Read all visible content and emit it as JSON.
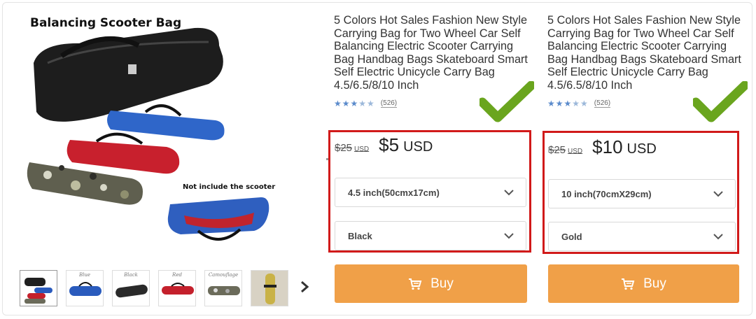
{
  "gallery": {
    "title": "Balancing Scooter Bag",
    "note": "Not include the scooter",
    "thumbnails": [
      {
        "label": "",
        "color": "#1f1f1f"
      },
      {
        "label": "Blue",
        "color": "#2a5bbd"
      },
      {
        "label": "Black",
        "color": "#2a2a2a"
      },
      {
        "label": "Red",
        "color": "#c4202c"
      },
      {
        "label": "Camouflage",
        "color": "#6b6b5a"
      },
      {
        "label": "",
        "color": "#c9b247"
      }
    ],
    "next_icon": "chevron-right-icon"
  },
  "products": [
    {
      "title": "5 Colors Hot Sales Fashion New Style Carrying Bag for Two Wheel Car Self Balancing Electric Scooter Carrying Bag Handbag Bags Skateboard Smart Self Electric Unicycle Carry Bag 4.5/6.5/8/10 Inch",
      "rating": 3.5,
      "review_count": "(526)",
      "old_price": "$25",
      "old_currency": "USD",
      "price": "$5",
      "currency": "USD",
      "size_select": "4.5 inch(50cmx17cm)",
      "color_select": "Black",
      "buy_label": "Buy"
    },
    {
      "title": "5 Colors Hot Sales Fashion New Style Carrying Bag for Two Wheel Car Self Balancing Electric Scooter Carrying Bag Handbag Bags Skateboard Smart Self Electric Unicycle Carry Bag 4.5/6.5/8/10 Inch",
      "rating": 3.5,
      "review_count": "(526)",
      "old_price": "$25",
      "old_currency": "USD",
      "price": "$10",
      "currency": "USD",
      "size_select": "10 inch(70cmX29cm)",
      "color_select": "Gold",
      "buy_label": "Buy"
    }
  ],
  "colors": {
    "highlight_border": "#d11a1a",
    "buy_button": "#f0a048",
    "checkmark": "#6aa51e",
    "stars": "#5b8bcc"
  }
}
